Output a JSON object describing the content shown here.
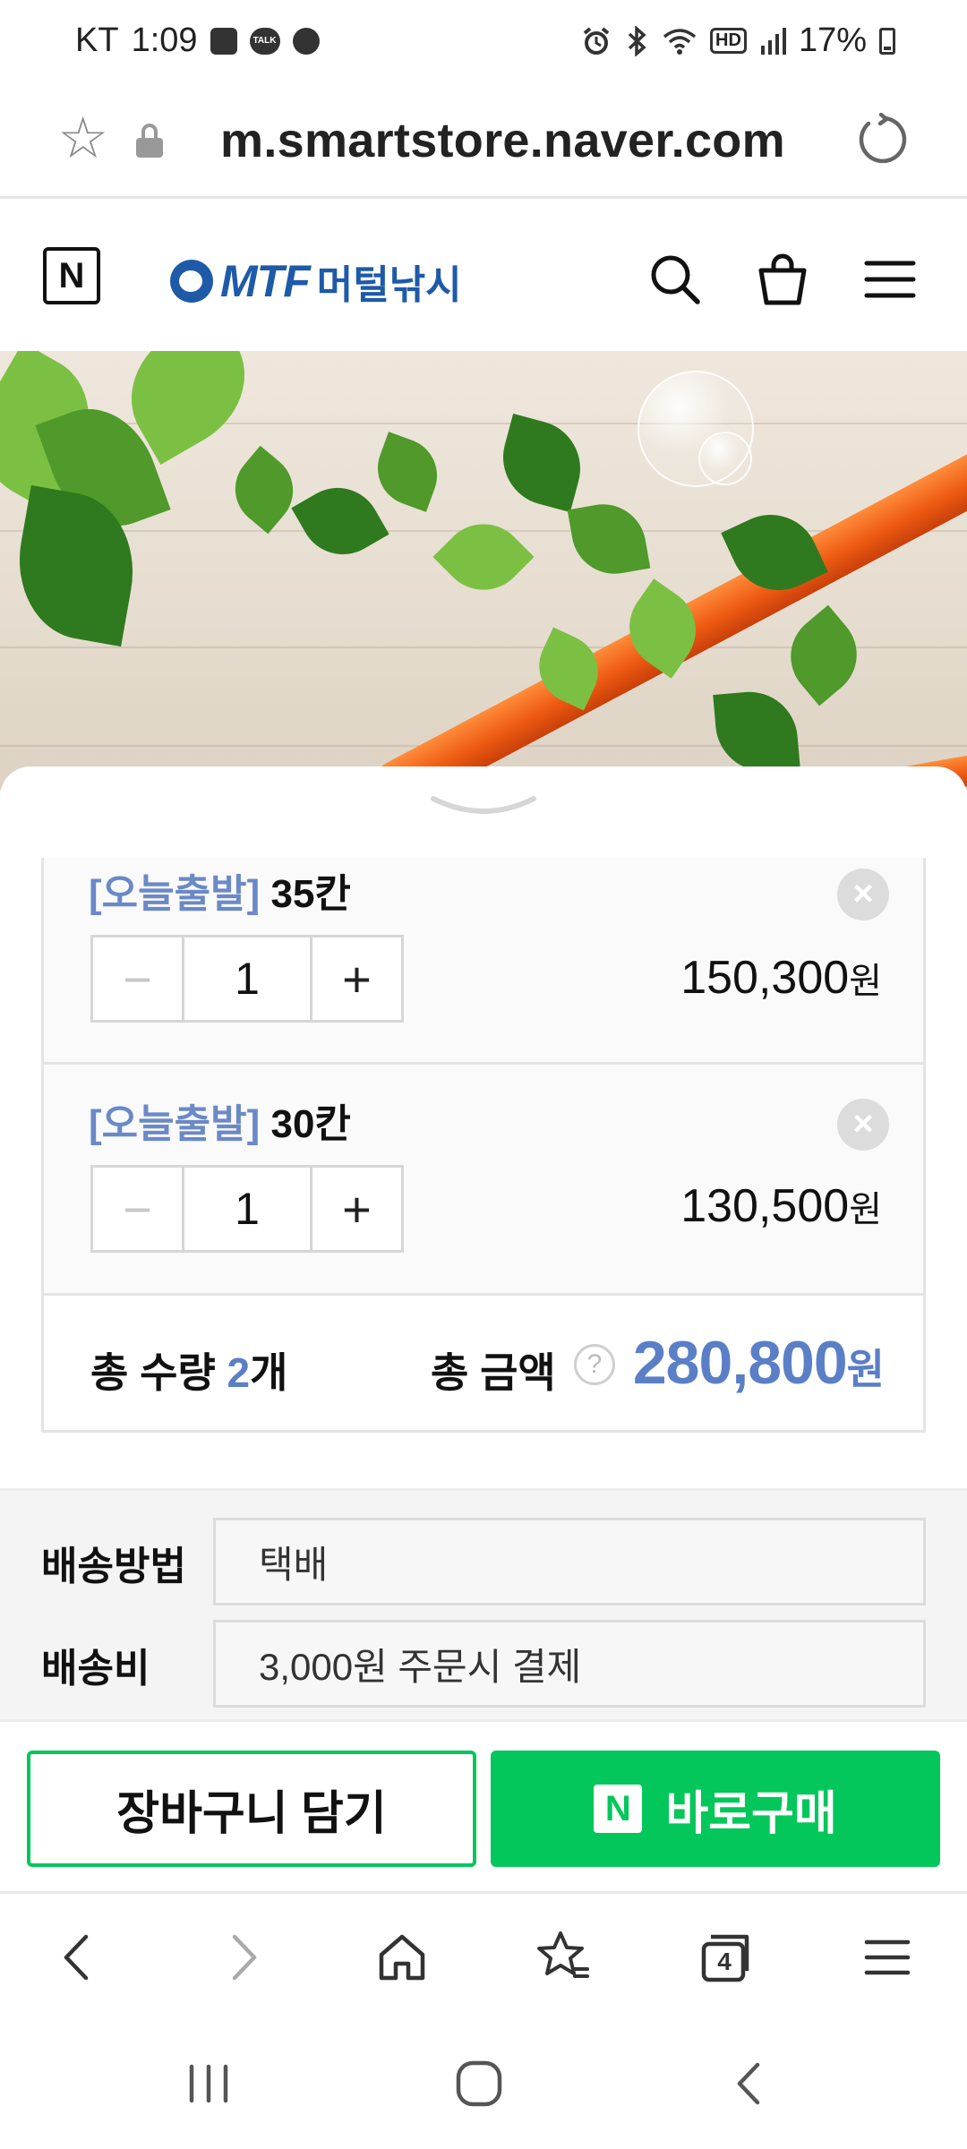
{
  "status_bar": {
    "carrier": "KT",
    "time": "1:09",
    "talk_badge": "TALK",
    "hd_badge": "HD",
    "battery": "17%"
  },
  "browser": {
    "url": "m.smartstore.naver.com"
  },
  "store_header": {
    "naver_logo": "N",
    "brand_mark": "MTF",
    "brand_name": "머털낚시"
  },
  "order_sheet": {
    "options": [
      {
        "tag": "[오늘출발]",
        "name": "35칸",
        "quantity": "1",
        "price": "150,300",
        "currency": "원"
      },
      {
        "tag": "[오늘출발]",
        "name": "30칸",
        "quantity": "1",
        "price": "130,500",
        "currency": "원"
      }
    ],
    "total": {
      "qty_label": "총 수량",
      "qty_value": "2",
      "qty_unit": "개",
      "amount_label": "총 금액",
      "help": "?",
      "amount_value": "280,800",
      "currency": "원"
    },
    "shipping": {
      "method_label": "배송방법",
      "method_value": "택배",
      "fee_label": "배송비",
      "fee_value": "3,000원 주문시 결제"
    }
  },
  "actions": {
    "cart_label": "장바구니 담기",
    "buy_icon": "N",
    "buy_label": "바로구매"
  },
  "browser_toolbar": {
    "tab_count": "4"
  },
  "colors": {
    "naver_green": "#03c75a",
    "accent_blue": "#5b7fc6",
    "tag_blue": "#6b89c7",
    "brand_blue": "#1e5aa8",
    "rod_orange": "#ee5a12"
  },
  "icons": {
    "status": [
      "gallery-icon",
      "talk-icon",
      "chat-bubble-icon",
      "alarm-icon",
      "bluetooth-icon",
      "wifi-icon",
      "hd-icon",
      "signal-icon",
      "battery-icon"
    ],
    "address_bar": [
      "bookmark-star-icon",
      "lock-icon",
      "reload-icon"
    ],
    "header": [
      "search-icon",
      "shopping-bag-icon",
      "menu-icon"
    ],
    "toolbar": [
      "back-icon",
      "forward-icon",
      "home-icon",
      "bookmarks-icon",
      "tabs-icon",
      "menu-icon"
    ],
    "navigation": [
      "recent-apps-icon",
      "home-nav-icon",
      "back-nav-icon"
    ]
  }
}
